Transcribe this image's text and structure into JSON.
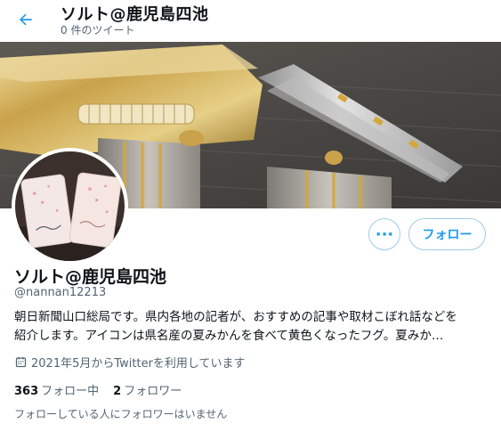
{
  "header": {
    "title": "ソルト@鹿児島四池",
    "subtitle": "0 件のツイート"
  },
  "profile": {
    "name": "ソルト@鹿児島四池",
    "handle": "@nannan12213",
    "bio_lines": [
      "朝日新聞山口総局です。県内各地の記者が、おすすめの記事や取材こぼれ話などを",
      "紹介します。アイコンは県名産の夏みかんを食べて黄色くなったフグ。夏みか…"
    ],
    "joined": "2021年5月からTwitterを利用しています",
    "following_count": "363",
    "following_label": "フォロー中",
    "followers_count": "2",
    "followers_label": "フォロワー",
    "followed_by_note": "フォローしている人にフォロワーはいません"
  },
  "actions": {
    "more_label": "···",
    "follow_label": "フォロー"
  },
  "icons": {
    "back": "arrow-left-icon",
    "more": "more-horizontal-icon",
    "calendar": "calendar-icon"
  },
  "colors": {
    "accent": "#1d9bf0",
    "button_border": "#9ecbe8",
    "secondary_text": "#536471",
    "primary_text": "#0f1419"
  }
}
